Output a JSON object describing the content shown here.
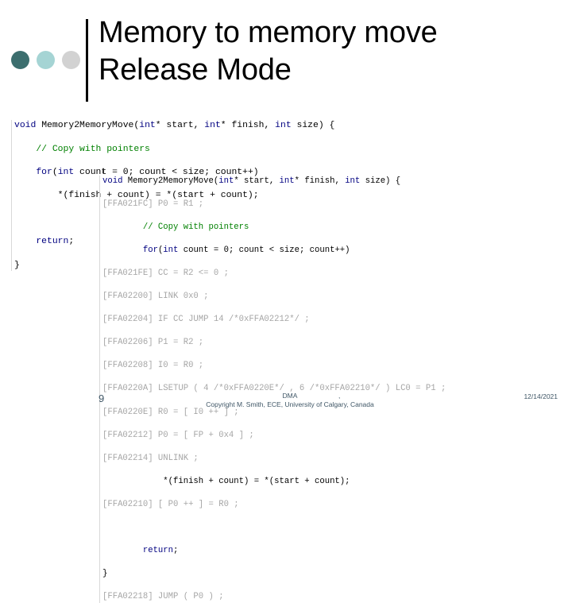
{
  "slide": {
    "title": "Memory to memory move\nRelease Mode",
    "decor_colors": [
      "#3c6e6e",
      "#a5d4d4",
      "#d2d2d2"
    ],
    "rule_color": "#000000"
  },
  "code_c": {
    "name": "c-source-code",
    "lines": [
      [
        {
          "t": "void ",
          "c": "kw"
        },
        {
          "t": "Memory2MemoryMove(",
          "c": "pln"
        },
        {
          "t": "int",
          "c": "kw"
        },
        {
          "t": "* start, ",
          "c": "pln"
        },
        {
          "t": "int",
          "c": "kw"
        },
        {
          "t": "* finish, ",
          "c": "pln"
        },
        {
          "t": "int",
          "c": "kw"
        },
        {
          "t": " size) {",
          "c": "pln"
        }
      ],
      [
        {
          "t": "    ",
          "c": "pln"
        },
        {
          "t": "// Copy with pointers",
          "c": "cmt"
        }
      ],
      [
        {
          "t": "    ",
          "c": "pln"
        },
        {
          "t": "for",
          "c": "kw"
        },
        {
          "t": "(",
          "c": "pln"
        },
        {
          "t": "int",
          "c": "kw"
        },
        {
          "t": " count = 0; count < size; count++)",
          "c": "pln"
        }
      ],
      [
        {
          "t": "        *(finish + count) = *(start + count);",
          "c": "pln"
        }
      ],
      [
        {
          "t": "",
          "c": "pln"
        }
      ],
      [
        {
          "t": "    ",
          "c": "pln"
        },
        {
          "t": "return",
          "c": "kw"
        },
        {
          "t": ";",
          "c": "pln"
        }
      ],
      [
        {
          "t": "}",
          "c": "pln"
        }
      ]
    ]
  },
  "code_asm": {
    "name": "mixed-c-assembly-listing",
    "lines": [
      [
        {
          "t": "void ",
          "c": "kw"
        },
        {
          "t": "Memory2MemoryMove(",
          "c": "pln"
        },
        {
          "t": "int",
          "c": "kw"
        },
        {
          "t": "* start, ",
          "c": "pln"
        },
        {
          "t": "int",
          "c": "kw"
        },
        {
          "t": "* finish, ",
          "c": "pln"
        },
        {
          "t": "int",
          "c": "kw"
        },
        {
          "t": " size) {",
          "c": "pln"
        }
      ],
      [
        {
          "t": "[FFA021FC] P0 = R1 ;",
          "c": "asm"
        }
      ],
      [
        {
          "t": "        ",
          "c": "pln"
        },
        {
          "t": "// Copy with pointers",
          "c": "cmt"
        }
      ],
      [
        {
          "t": "        ",
          "c": "pln"
        },
        {
          "t": "for",
          "c": "kw"
        },
        {
          "t": "(",
          "c": "pln"
        },
        {
          "t": "int",
          "c": "kw"
        },
        {
          "t": " count = 0; count < size; count++)",
          "c": "pln"
        }
      ],
      [
        {
          "t": "[FFA021FE] CC = R2 <= 0 ;",
          "c": "asm"
        }
      ],
      [
        {
          "t": "[FFA02200] LINK 0x0 ;",
          "c": "asm"
        }
      ],
      [
        {
          "t": "[FFA02204] IF CC JUMP 14 /*0xFFA02212*/ ;",
          "c": "asm"
        }
      ],
      [
        {
          "t": "[FFA02206] P1 = R2 ;",
          "c": "asm"
        }
      ],
      [
        {
          "t": "[FFA02208] I0 = R0 ;",
          "c": "asm"
        }
      ],
      [
        {
          "t": "[FFA0220A] LSETUP ( 4 /*0xFFA0220E*/ , 6 /*0xFFA02210*/ ) LC0 = P1 ;",
          "c": "asm"
        }
      ],
      [
        {
          "t": "[FFA0220E] R0 = [ I0 ++ ] ;",
          "c": "asm"
        }
      ],
      [
        {
          "t": "[FFA02212] P0 = [ FP + 0x4 ] ;",
          "c": "asm"
        }
      ],
      [
        {
          "t": "[FFA02214] UNLINK ;",
          "c": "asm"
        }
      ],
      [
        {
          "t": "            *(finish + count) = *(start + count);",
          "c": "pln"
        }
      ],
      [
        {
          "t": "[FFA02210] [ P0 ++ ] = R0 ;",
          "c": "asm"
        }
      ],
      [
        {
          "t": "",
          "c": "pln"
        }
      ],
      [
        {
          "t": "        ",
          "c": "pln"
        },
        {
          "t": "return",
          "c": "kw"
        },
        {
          "t": ";",
          "c": "pln"
        }
      ],
      [
        {
          "t": "}",
          "c": "pln"
        }
      ],
      [
        {
          "t": "[FFA02218] JUMP ( P0 ) ;",
          "c": "asm"
        }
      ]
    ]
  },
  "footer": {
    "page_number": "9",
    "subject": "DMA",
    "copyright": "Copyright M. Smith, ECE, University of Calgary, Canada",
    "separator": ",",
    "date": "12/14/2021"
  }
}
